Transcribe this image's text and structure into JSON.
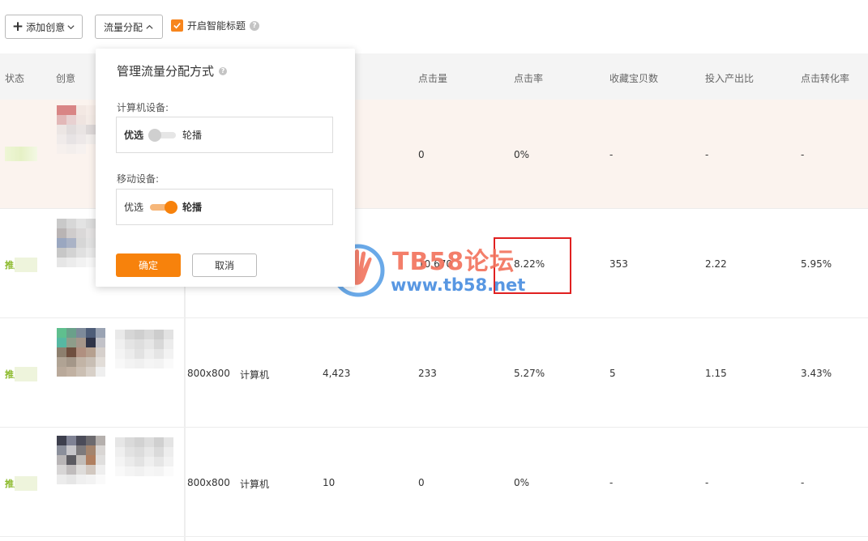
{
  "toolbar": {
    "add_label": "添加创意",
    "flow_label": "流量分配",
    "smart_title_label": "开启智能标题"
  },
  "table": {
    "headers": {
      "status": "状态",
      "creative": "创意",
      "clicks": "点击量",
      "ctr": "点击率",
      "favorites": "收藏宝贝数",
      "roi": "投入产出比",
      "cvr": "点击转化率"
    },
    "rows": [
      {
        "status": "",
        "size": "",
        "device": "",
        "impressions": "",
        "clicks": "0",
        "ctr": "0%",
        "favorites": "-",
        "roi": "-",
        "cvr": "-"
      },
      {
        "status": "推广",
        "size": "",
        "device": "",
        "impressions": "",
        "clicks": "10,670",
        "ctr": "8.22%",
        "favorites": "353",
        "roi": "2.22",
        "cvr": "5.95%"
      },
      {
        "status": "推广",
        "size": "800x800",
        "device": "计算机",
        "impressions": "4,423",
        "clicks": "233",
        "ctr": "5.27%",
        "favorites": "5",
        "roi": "1.15",
        "cvr": "3.43%"
      },
      {
        "status": "推广",
        "size": "800x800",
        "device": "计算机",
        "impressions": "10",
        "clicks": "0",
        "ctr": "0%",
        "favorites": "-",
        "roi": "-",
        "cvr": "-"
      }
    ]
  },
  "popup": {
    "title": "管理流量分配方式",
    "pc_label": "计算机设备:",
    "pc_left": "优选",
    "pc_right": "轮播",
    "mobile_label": "移动设备:",
    "mobile_left": "优选",
    "mobile_right": "轮播",
    "ok_label": "确定",
    "cancel_label": "取消"
  },
  "watermark": {
    "line1": "TB58论坛",
    "line2": "www.tb58.net"
  },
  "colors": {
    "accent": "#f7820c",
    "status_green": "#8cba2c",
    "highlight_row": "#fbf3ee",
    "annotation_red": "#e02020"
  },
  "icons": {
    "add": "plus-icon",
    "dropdown": "chevron-down-icon",
    "collapse": "chevron-up-icon",
    "checkbox": "check-icon",
    "help": "question-icon",
    "watermark_logo": "hand-logo-icon"
  }
}
